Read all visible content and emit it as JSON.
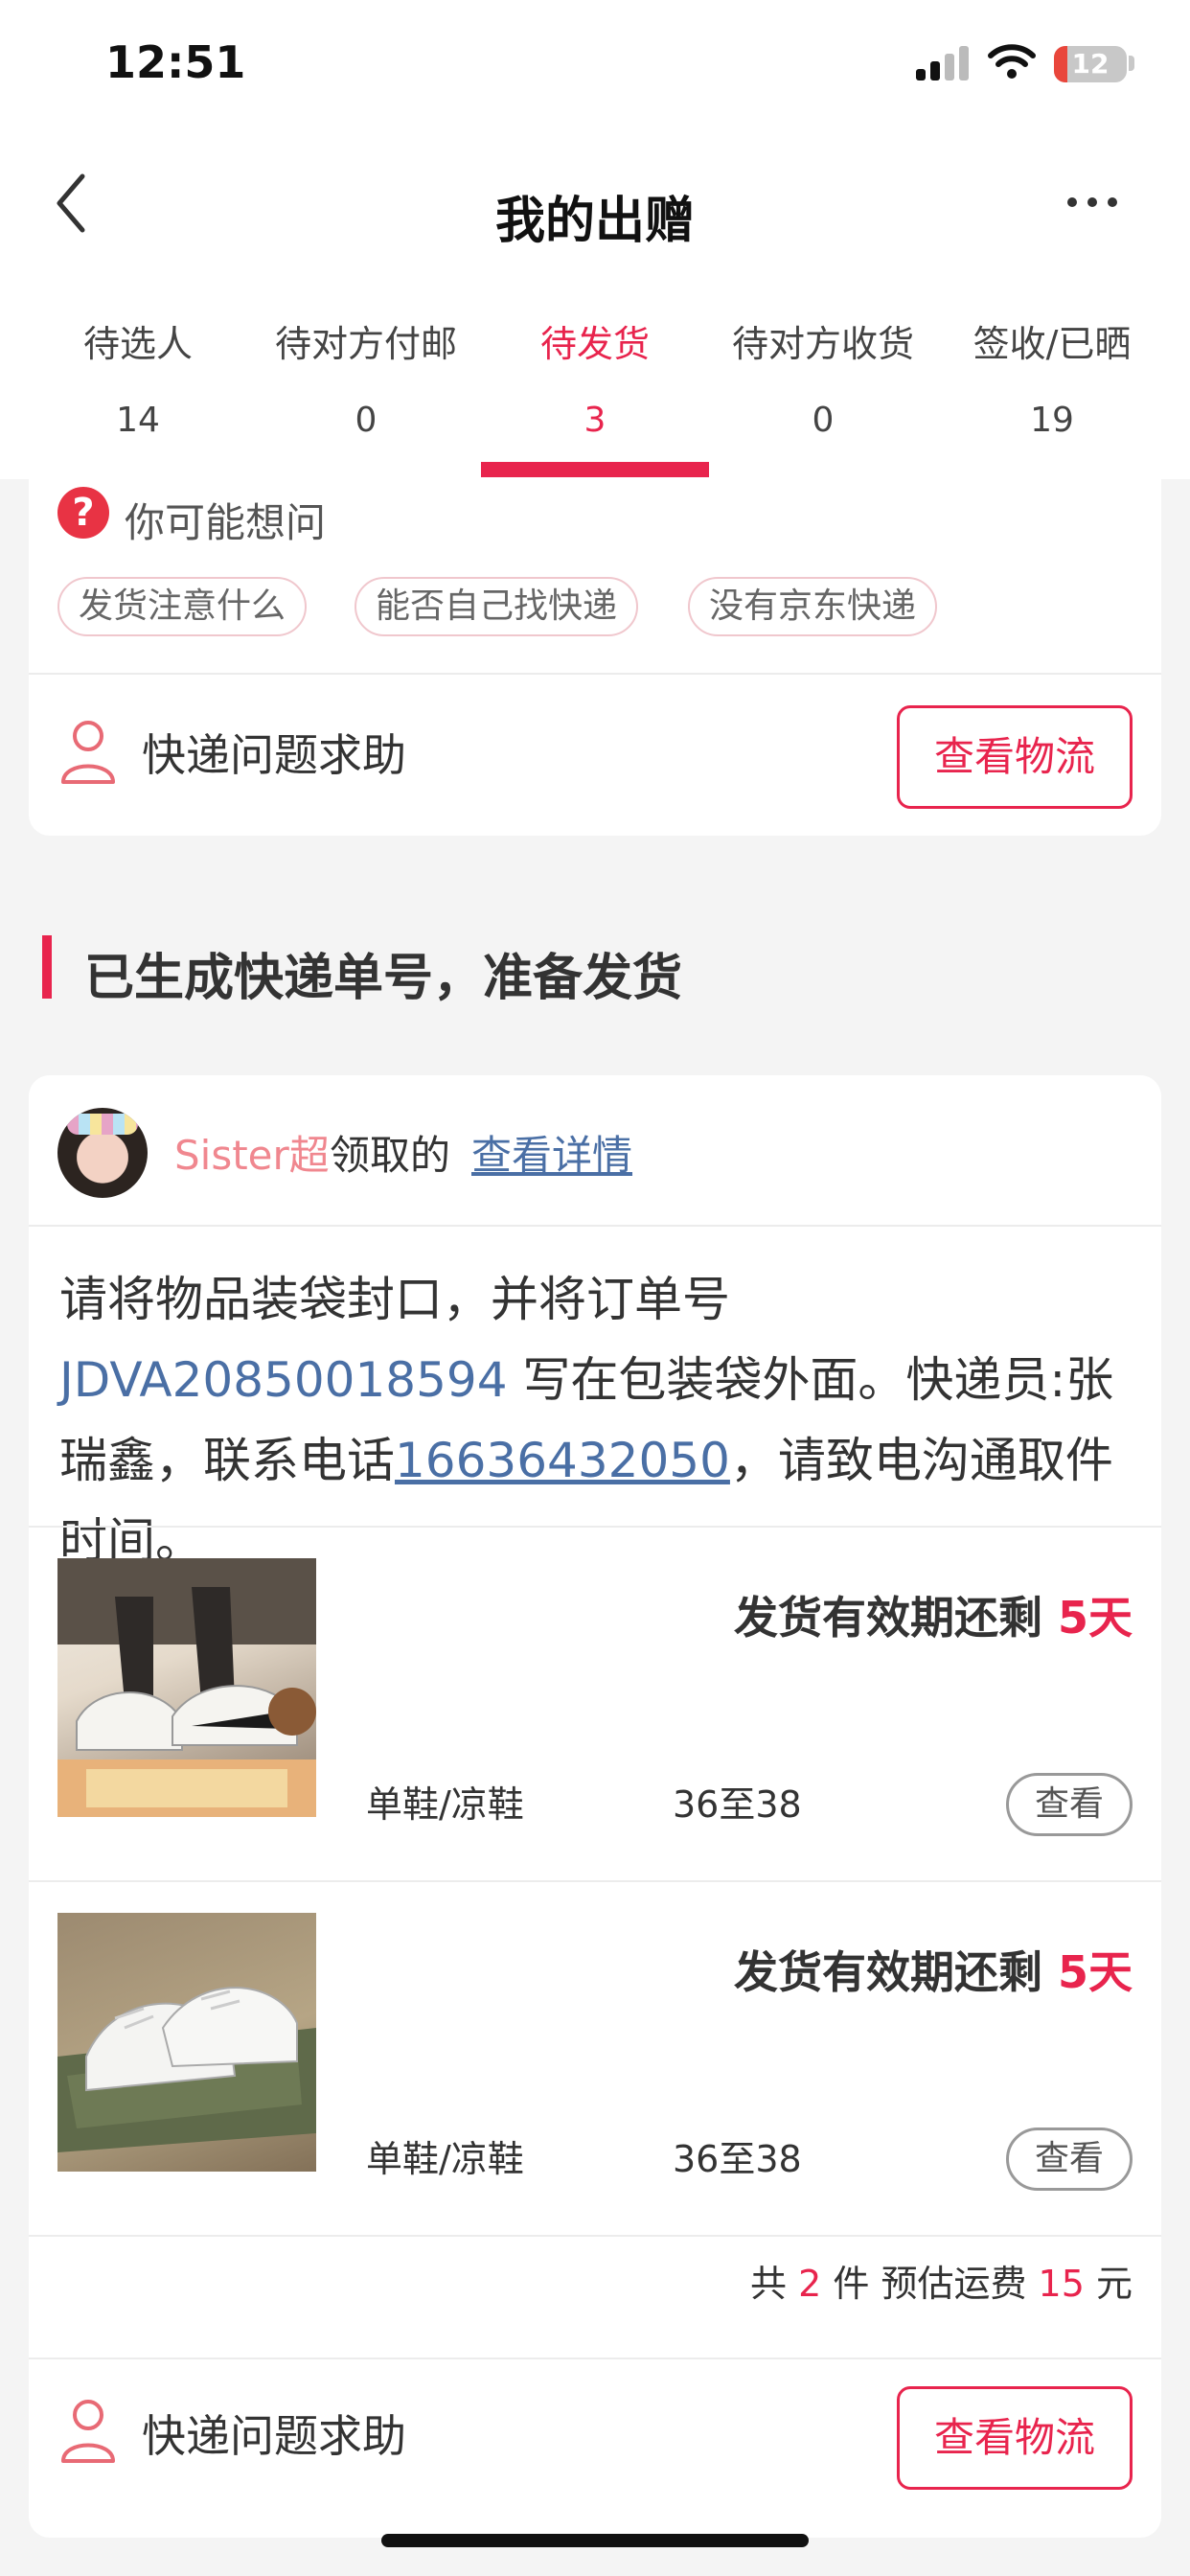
{
  "status_bar": {
    "time": "12:51",
    "battery": "12"
  },
  "nav": {
    "title": "我的出赠"
  },
  "tabs": [
    {
      "label": "待选人",
      "count": "14"
    },
    {
      "label": "待对方付邮",
      "count": "0"
    },
    {
      "label": "待发货",
      "count": "3",
      "active": true
    },
    {
      "label": "待对方收货",
      "count": "0"
    },
    {
      "label": "签收/已晒",
      "count": "19"
    }
  ],
  "faq": {
    "title": "你可能想问",
    "chips": [
      "发货注意什么",
      "能否自己找快递",
      "没有京东快递"
    ]
  },
  "help": {
    "label": "快递问题求助",
    "logistics_button": "查看物流"
  },
  "section": {
    "title": "已生成快递单号，准备发货"
  },
  "order": {
    "user": "Sister超",
    "claim_text": "领取的",
    "details_link": "查看详情",
    "instruction_prefix": "请将物品装袋封口，并将订单号 ",
    "order_number": "JDVA20850018594",
    "instruction_mid": " 写在包装袋外面。快递员:张瑞鑫，联系电话",
    "phone": "16636432050",
    "instruction_suffix": "，请致电沟通取件时间。",
    "items": [
      {
        "deadline_label": "发货有效期还剩 ",
        "days": "5天",
        "category": "单鞋/凉鞋",
        "size": "36至38",
        "view_button": "查看"
      },
      {
        "deadline_label": "发货有效期还剩 ",
        "days": "5天",
        "category": "单鞋/凉鞋",
        "size": "36至38",
        "view_button": "查看"
      }
    ],
    "summary": {
      "prefix": "共 ",
      "count": "2",
      "mid": " 件 预估运费 ",
      "fee": "15",
      "suffix": " 元"
    }
  },
  "colors": {
    "accent": "#e8244d",
    "link": "#4a6fa5",
    "background": "#f4f4f4"
  }
}
